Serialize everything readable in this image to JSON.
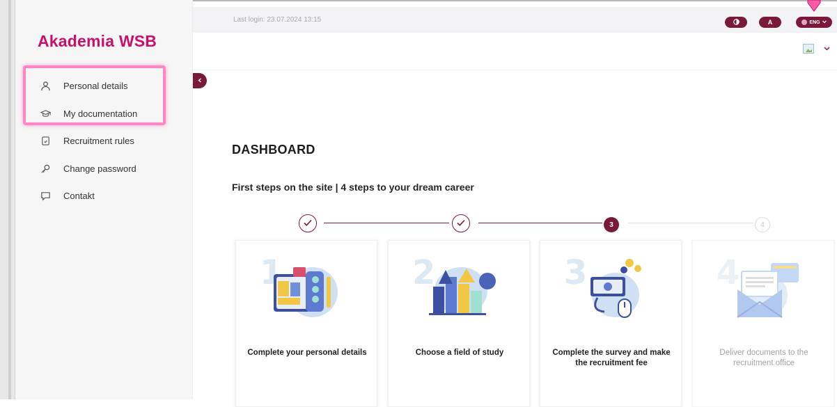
{
  "brand": {
    "logo_text": "Akademia WSB",
    "accent_color": "#c8106b",
    "primary_color": "#7a1a3a"
  },
  "topbar": {
    "last_login": "Last login: 23.07.2024 13:15",
    "contrast_icon": "contrast-icon",
    "font_button_label": "A",
    "language_label": "ENG"
  },
  "sidebar": {
    "items": [
      {
        "label": "Personal details",
        "icon": "person-icon"
      },
      {
        "label": "My documentation",
        "icon": "graduation-cap-icon"
      },
      {
        "label": "Recruitment rules",
        "icon": "document-icon"
      },
      {
        "label": "Change password",
        "icon": "key-icon"
      },
      {
        "label": "Contakt",
        "icon": "chat-bubble-icon"
      }
    ]
  },
  "main": {
    "title": "DASHBOARD",
    "steps_heading": "First steps on the site | 4 steps to your dream career",
    "stepper": [
      {
        "status": "done",
        "label": ""
      },
      {
        "status": "done",
        "label": ""
      },
      {
        "status": "current",
        "label": "3"
      },
      {
        "status": "pending",
        "label": "4"
      }
    ],
    "cards": [
      {
        "number": "1",
        "text": "Complete your personal details",
        "icon": "documents-illustration"
      },
      {
        "number": "2",
        "text": "Choose a field of study",
        "icon": "growth-chart-illustration"
      },
      {
        "number": "3",
        "text": "Complete the survey and make the recruitment fee",
        "icon": "payment-illustration"
      },
      {
        "number": "4",
        "text": "Deliver documents to the recruitment office",
        "icon": "envelope-illustration"
      }
    ]
  }
}
